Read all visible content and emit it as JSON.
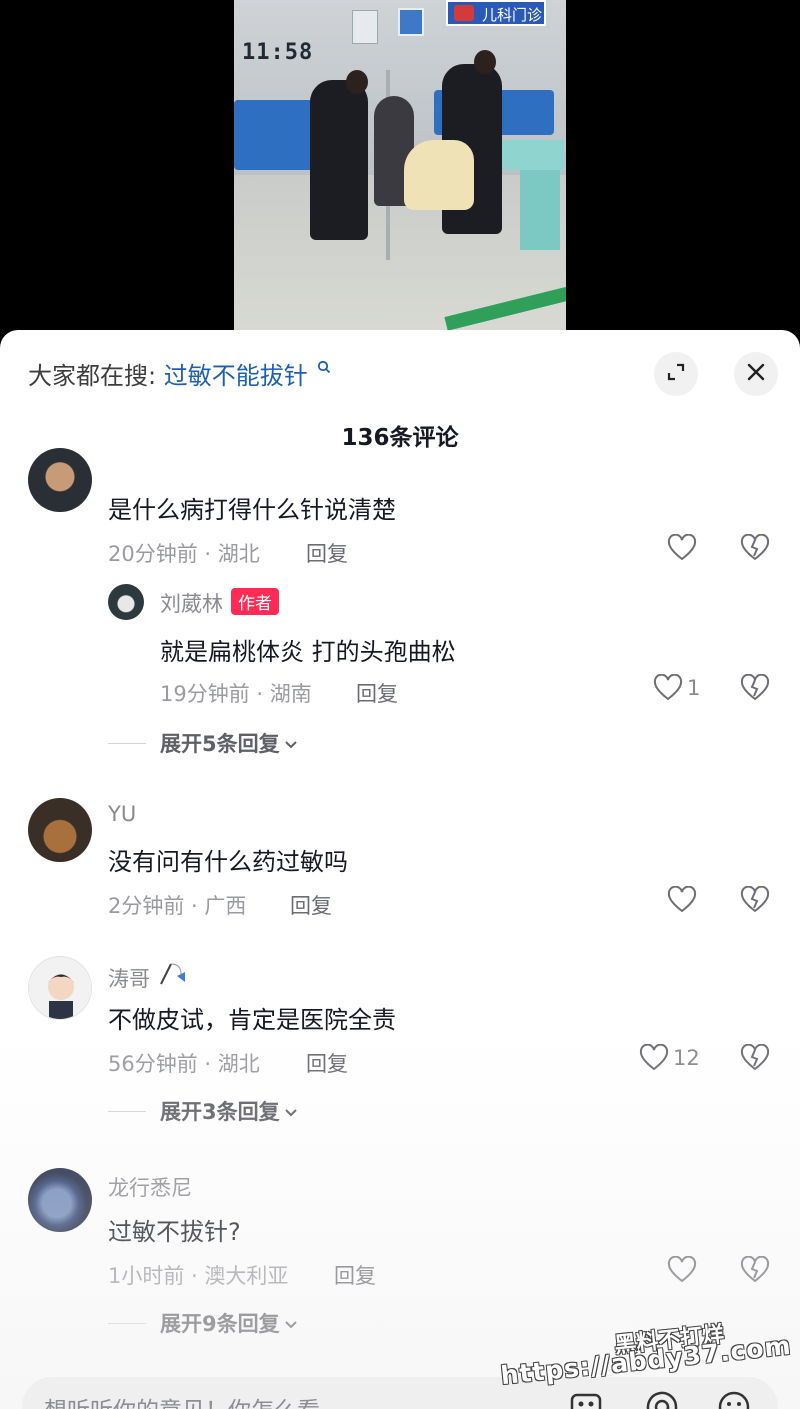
{
  "video": {
    "timestamp": "11:58",
    "sign_text": "儿科门诊"
  },
  "search": {
    "prefix": "大家都在搜:",
    "query": "过敏不能拔针",
    "search_icon": "search-icon"
  },
  "header": {
    "comment_count": "136条评论",
    "expand_icon": "expand-icon",
    "close_icon": "close-icon"
  },
  "comments": [
    {
      "name": "",
      "text": "是什么病打得什么针说清楚",
      "meta": "20分钟前 · 湖北",
      "reply_label": "回复",
      "likes": "",
      "replies": [
        {
          "name": "刘葳林",
          "badge": "作者",
          "text": "就是扁桃体炎  打的头孢曲松",
          "meta": "19分钟前 · 湖南",
          "reply_label": "回复",
          "likes": "1"
        }
      ],
      "expand_label": "展开5条回复"
    },
    {
      "name": "YU",
      "text": "没有问有什么药过敏吗",
      "meta": "2分钟前 · 广西",
      "reply_label": "回复",
      "likes": ""
    },
    {
      "name": "涛哥",
      "text": "不做皮试，肯定是医院全责",
      "meta": "56分钟前 · 湖北",
      "reply_label": "回复",
      "likes": "12",
      "expand_label": "展开3条回复"
    },
    {
      "name": "龙行悉尼",
      "text": "过敏不拔针?",
      "meta": "1小时前 · 澳大利亚",
      "reply_label": "回复",
      "likes": "",
      "expand_label": "展开9条回复"
    }
  ],
  "input": {
    "placeholder": "想听听你的意见！你怎么看",
    "icons": [
      "image-icon",
      "at-icon",
      "emoji-icon"
    ]
  },
  "watermark": {
    "line1": "黑料不打烊",
    "line2": "https://abdy37.com"
  }
}
